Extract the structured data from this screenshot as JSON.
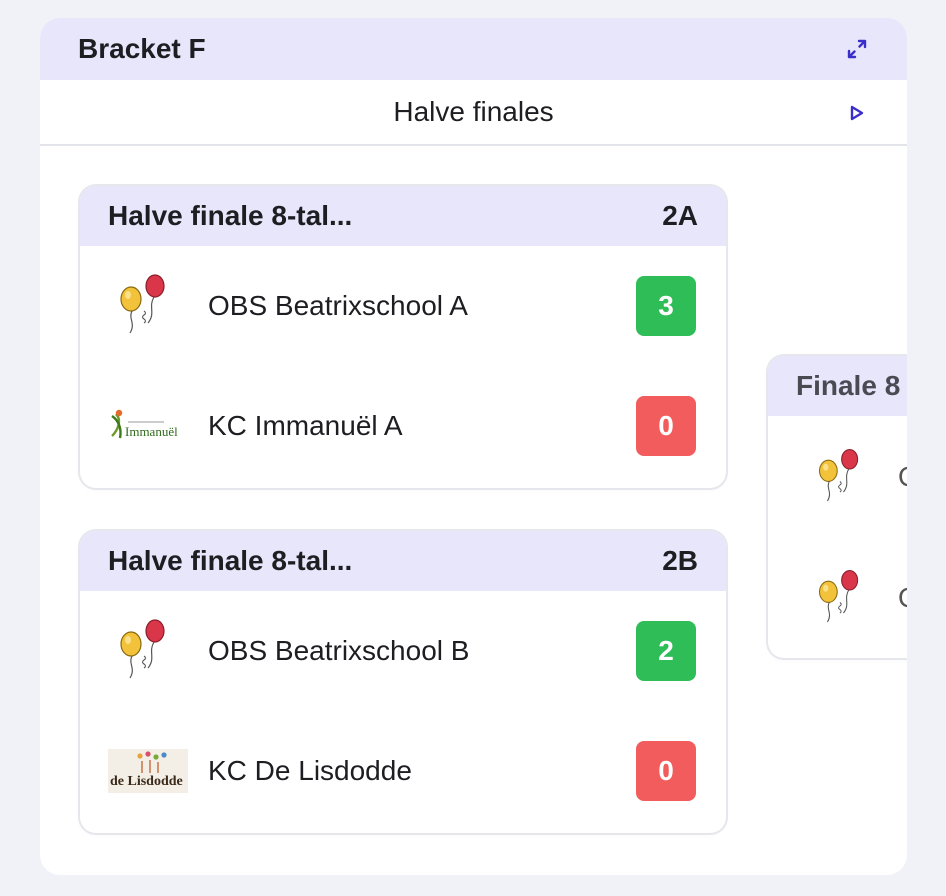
{
  "panel": {
    "title": "Bracket F"
  },
  "round": {
    "title": "Halve finales"
  },
  "colors": {
    "header_bg": "#e8e6fb",
    "win": "#2fbd58",
    "loss": "#f25c5c",
    "accent": "#3b2fc9"
  },
  "matches": [
    {
      "title": "Halve finale 8-tal...",
      "code": "2A",
      "teams": [
        {
          "name": "OBS Beatrixschool A",
          "score": "3",
          "logo": "balloons-logo",
          "result": "win"
        },
        {
          "name": "KC Immanuël A",
          "score": "0",
          "logo": "immanuel-logo",
          "result": "loss",
          "logo_text": "Immanuël"
        }
      ]
    },
    {
      "title": "Halve finale 8-tal...",
      "code": "2B",
      "teams": [
        {
          "name": "OBS Beatrixschool B",
          "score": "2",
          "logo": "balloons-logo",
          "result": "win"
        },
        {
          "name": "KC De Lisdodde",
          "score": "0",
          "logo": "lisdodde-logo",
          "result": "loss",
          "logo_text": "de Lisdodde"
        }
      ]
    },
    {
      "title": "Finale 8",
      "teams": [
        {
          "name": "O",
          "logo": "balloons-logo"
        },
        {
          "name": "O",
          "logo": "balloons-logo"
        }
      ]
    }
  ]
}
